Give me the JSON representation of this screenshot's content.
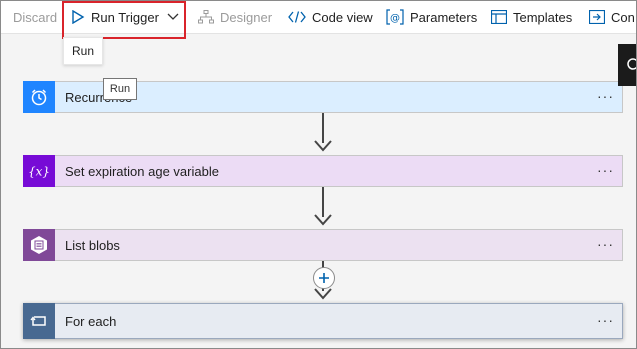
{
  "toolbar": {
    "discard": "Discard",
    "run_trigger": "Run Trigger",
    "designer": "Designer",
    "code_view": "Code view",
    "parameters": "Parameters",
    "templates": "Templates",
    "connectors_partial": "Con"
  },
  "run_menu": {
    "item": "Run"
  },
  "tooltip": {
    "text": "Run"
  },
  "steps": [
    {
      "title": "Recurrence",
      "icon": "clock-icon",
      "color": "#1f85ff"
    },
    {
      "title": "Set expiration age variable",
      "icon": "variable-icon",
      "color": "#770bd6"
    },
    {
      "title": "List blobs",
      "icon": "storage-blob-icon",
      "color": "#804998"
    },
    {
      "title": "For each",
      "icon": "loop-icon",
      "color": "#486991"
    }
  ],
  "more_label": "···",
  "colors": {
    "highlight": "#d9242b",
    "accent": "#0062ad"
  }
}
